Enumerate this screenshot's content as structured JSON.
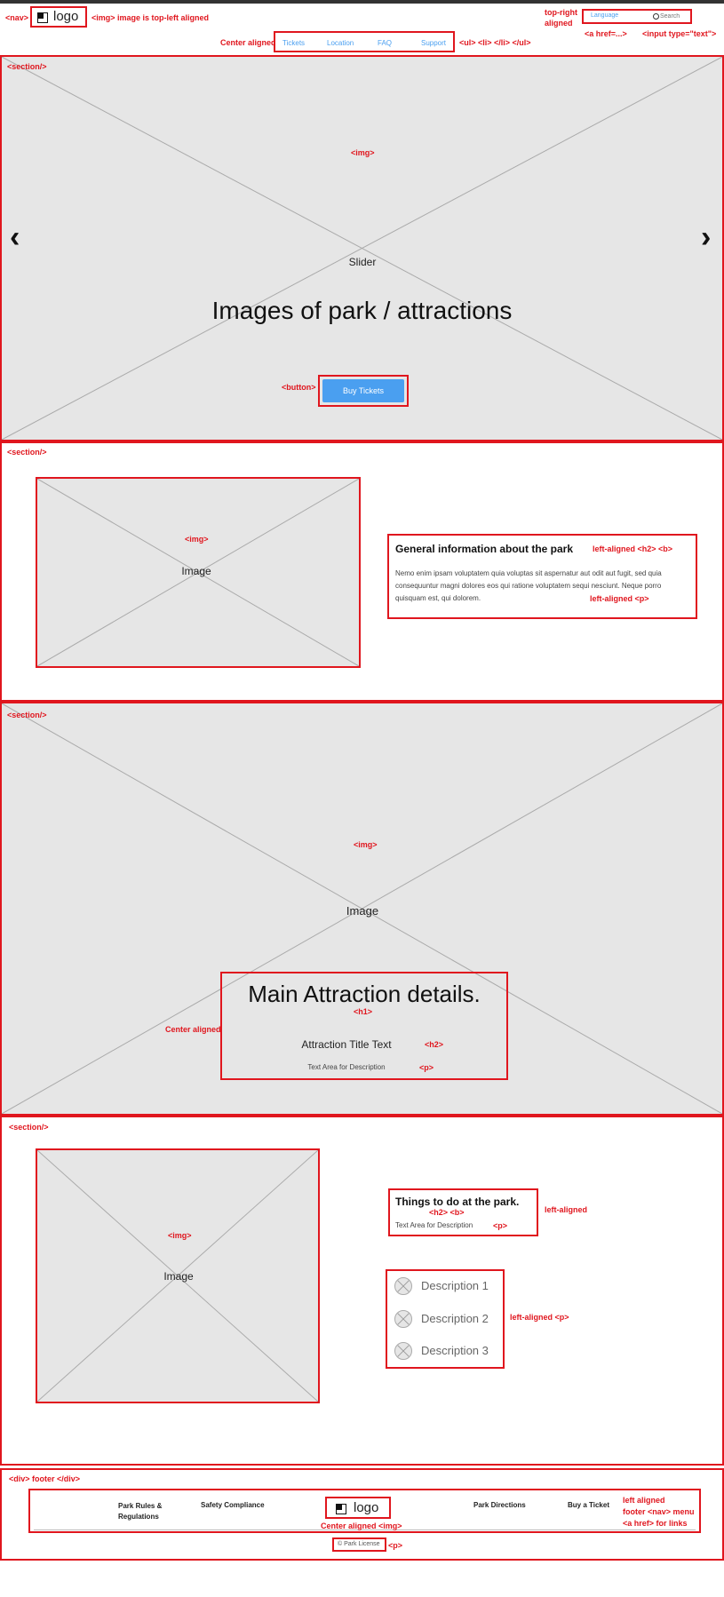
{
  "nav": {
    "tag_annotation": "<nav>",
    "logo_text": "logo",
    "logo_annotation": "<img> image is top-left aligned",
    "links": [
      "Tickets",
      "Location",
      "FAQ",
      "Support"
    ],
    "links_annotation_left": "Center aligned",
    "links_annotation_right": "<ul> <li> </li> </ul>",
    "language_label": "Language",
    "search_placeholder": "Search",
    "topright_annotation_line1": "top-right",
    "topright_annotation_line2": "aligned",
    "href_annotation": "<a href=...>",
    "input_annotation": "<input type=\"text\">"
  },
  "hero": {
    "section_tag": "<section/>",
    "img_tag": "<img>",
    "slider_label": "Slider",
    "headline": "Images of park / attractions",
    "button_tag": "<button>",
    "button_label": "Buy Tickets",
    "prev_arrow": "‹",
    "next_arrow": "›"
  },
  "info": {
    "section_tag": "<section/>",
    "img_tag": "<img>",
    "image_label": "Image",
    "heading": "General information about the park",
    "heading_annotation": "left-aligned <h2> <b>",
    "body": "Nemo enim ipsam voluptatem quia voluptas sit aspernatur aut odit aut fugit, sed quia consequuntur magni dolores eos qui ratione voluptatem sequi nesciunt. Neque porro quisquam est, qui dolorem.",
    "body_annotation": "left-aligned <p>"
  },
  "attraction": {
    "section_tag": "<section/>",
    "img_tag": "<img>",
    "image_label": "Image",
    "title": "Main Attraction details.",
    "h1_annotation": "<h1>",
    "subtitle": "Attraction Title Text",
    "h2_annotation": "<h2>",
    "description": "Text Area for Description",
    "p_annotation": "<p>",
    "center_annotation": "Center aligned"
  },
  "things": {
    "section_tag": "<section/>",
    "img_tag": "<img>",
    "image_label": "Image",
    "heading": "Things to do at the park.",
    "heading_annotation": "<h2> <b>",
    "description": "Text Area for Description",
    "p_annotation": "<p>",
    "left_annotation": "left-aligned",
    "items": [
      "Description 1",
      "Description 2",
      "Description 3"
    ],
    "items_annotation": "left-aligned <p>"
  },
  "footer": {
    "tag_annotation": "<div> footer </div>",
    "links_left": [
      "Park Rules & Regulations",
      "Safety Compliance"
    ],
    "links_right": [
      "Park Directions",
      "Buy a Ticket"
    ],
    "logo_text": "logo",
    "logo_annotation": "Center aligned <img>",
    "nav_annotation_line1": "left aligned",
    "nav_annotation_line2": "footer <nav> menu",
    "nav_annotation_line3": "<a href> for links",
    "license": "© Park License",
    "license_annotation": "<p>"
  }
}
